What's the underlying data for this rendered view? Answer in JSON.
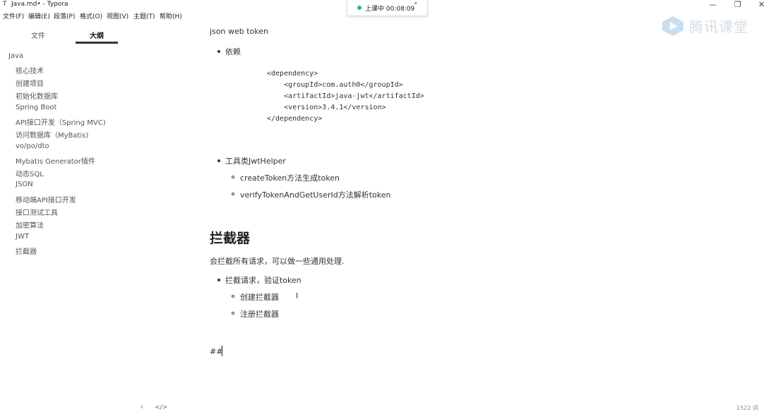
{
  "window": {
    "app_icon": "T",
    "title": "Java.md• - Typora"
  },
  "menu": [
    "文件(F)",
    "编辑(E)",
    "段落(P)",
    "格式(O)",
    "视图(V)",
    "主题(T)",
    "帮助(H)"
  ],
  "class_status": {
    "text": "上课中 00:08:09",
    "status_color": "#20c373"
  },
  "watermark": {
    "text": "腾讯课堂"
  },
  "sidebar": {
    "tabs": [
      "文件",
      "大纲"
    ],
    "active_tab": "大纲",
    "root": "Java",
    "items": [
      "核心技术",
      "创建项目",
      "初始化数据库",
      "Spring Boot",
      "API接口开发（Spring MVC)",
      "访问数据库（MyBatis)",
      "vo/po/dto",
      "Mybatis Generator插件",
      "动态SQL",
      "JSON",
      "移动端API接口开发",
      "接口测试工具",
      "加密算法",
      "JWT",
      "拦截器"
    ]
  },
  "doc": {
    "line1": "json web token",
    "bullet_dep": "依赖",
    "code": [
      "<dependency>",
      "    <groupId>com.auth0</groupId>",
      "    <artifactId>java-jwt</artifactId>",
      "    <version>3.4.1</version>",
      "</dependency>"
    ],
    "bullet_tool": "工具类JwtHelper",
    "sub_tool": [
      "createToken方法生成token",
      "verifyTokenAndGetUserId方法解析token"
    ],
    "heading": "拦截器",
    "para": "会拦截所有请求，可以做一些通用处理.",
    "bullet_intercept": "拦截请求，验证token",
    "sub_intercept": [
      "创建拦截器",
      "注册拦截器"
    ],
    "typing": "##"
  },
  "footer": {
    "word_count": "1522 词"
  }
}
